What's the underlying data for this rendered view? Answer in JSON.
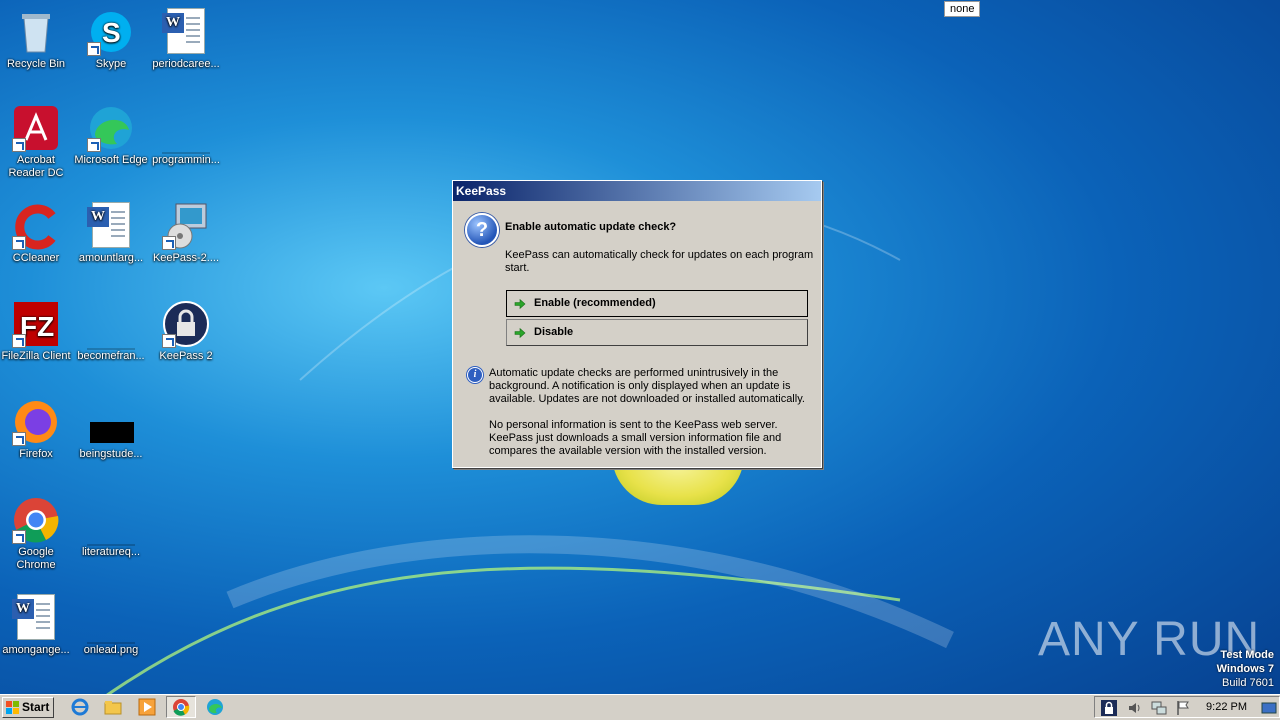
{
  "screen": {
    "none_label": "none"
  },
  "desktop_icons": [
    {
      "label": "Recycle Bin",
      "icon": "recycle-bin-icon"
    },
    {
      "label": "Skype",
      "icon": "skype-icon"
    },
    {
      "label": "periodcaree...",
      "icon": "word-document-icon"
    },
    {
      "label": "Acrobat Reader DC",
      "icon": "acrobat-icon"
    },
    {
      "label": "Microsoft Edge",
      "icon": "edge-icon"
    },
    {
      "label": "programmin...",
      "icon": "blank-file-icon"
    },
    {
      "label": "CCleaner",
      "icon": "ccleaner-icon"
    },
    {
      "label": "amountlarg...",
      "icon": "word-document-icon"
    },
    {
      "label": "KeePass-2....",
      "icon": "installer-icon"
    },
    {
      "label": "FileZilla Client",
      "icon": "filezilla-icon"
    },
    {
      "label": "becomefran...",
      "icon": "blank-file-icon"
    },
    {
      "label": "KeePass 2",
      "icon": "keepass-icon"
    },
    {
      "label": "Firefox",
      "icon": "firefox-icon"
    },
    {
      "label": "beingstude...",
      "icon": "image-file-icon"
    },
    {
      "label": "Google Chrome",
      "icon": "chrome-icon"
    },
    {
      "label": "literatureq...",
      "icon": "blank-file-icon"
    },
    {
      "label": "amongange...",
      "icon": "word-document-icon"
    },
    {
      "label": "onlead.png",
      "icon": "blank-file-icon"
    }
  ],
  "dialog": {
    "title": "KeePass",
    "main_instruction": "Enable automatic update check?",
    "content": "KeePass can automatically check for updates on each program start.",
    "commands": [
      {
        "label": "Enable (recommended)"
      },
      {
        "label": "Disable"
      }
    ],
    "footer_1": "Automatic update checks are performed unintrusively in the background. A notification is only displayed when an update is available. Updates are not downloaded or installed automatically.",
    "footer_2": "No personal information is sent to the KeePass web server. KeePass just downloads a small version information file and compares the available version with the installed version."
  },
  "watermark": {
    "text": "ANY RUN"
  },
  "test_mode": {
    "line1": "Test Mode",
    "line2": "Windows 7",
    "line3": "Build 7601"
  },
  "taskbar": {
    "start_label": "Start",
    "quick_launch": [
      "internet-explorer-icon",
      "folder-icon",
      "media-player-icon",
      "chrome-icon",
      "edge-icon"
    ],
    "tray_icons": [
      "keepass-tray-icon",
      "volume-icon",
      "network-icon",
      "flag-icon"
    ],
    "clock": "9:22 PM"
  }
}
